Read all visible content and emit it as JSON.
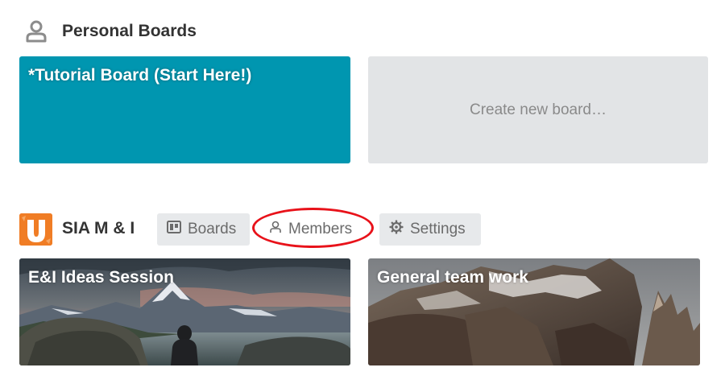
{
  "personal_section": {
    "title": "Personal Boards",
    "icon": "person-icon"
  },
  "personal_boards": [
    {
      "title": "*Tutorial Board (Start Here!)",
      "color": "#0096b0"
    }
  ],
  "create_board": {
    "label": "Create new board…"
  },
  "team": {
    "name": "SIA M & I",
    "logo_color": "#f07d25",
    "logo_letter": "U",
    "tabs": [
      {
        "label": "Boards",
        "icon": "board-icon"
      },
      {
        "label": "Members",
        "icon": "person-icon",
        "highlighted": true
      },
      {
        "label": "Settings",
        "icon": "gear-icon"
      }
    ],
    "highlight_color": "#e8121a",
    "boards": [
      {
        "title": "E&I Ideas Session",
        "background": "mountain-lake-photo"
      },
      {
        "title": "General team work",
        "background": "rocky-peaks-photo"
      }
    ]
  }
}
